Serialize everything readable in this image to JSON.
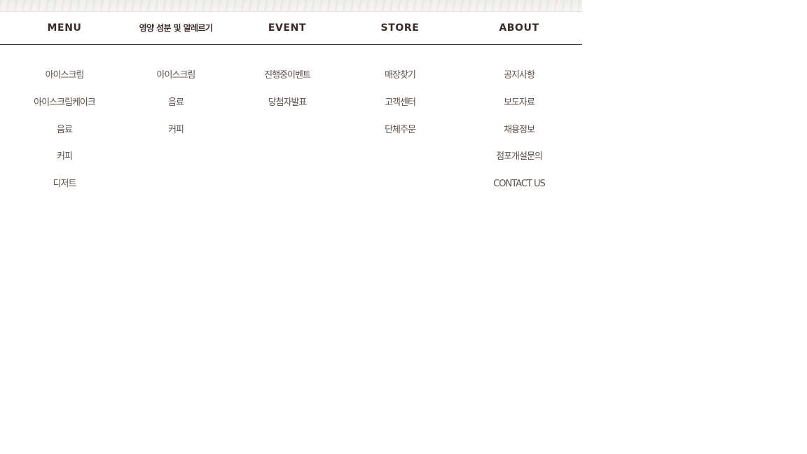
{
  "nav": [
    {
      "label": "MENU"
    },
    {
      "label": "영양 성분 및 알레르기"
    },
    {
      "label": "EVENT"
    },
    {
      "label": "STORE"
    },
    {
      "label": "ABOUT"
    }
  ],
  "submenus": [
    [
      "아이스크림",
      "아이스크림케이크",
      "음료",
      "커피",
      "디저트"
    ],
    [
      "아이스크림",
      "음료",
      "커피"
    ],
    [
      "진행중이벤트",
      "당첨자발표"
    ],
    [
      "매장찾기",
      "고객센터",
      "단체주문"
    ],
    [
      "공지사항",
      "보도자료",
      "채용정보",
      "점포개설문의",
      "CONTACT US"
    ]
  ],
  "colors": {
    "nav_text": "#3c2a28",
    "sub_text": "#5d514c",
    "divider": "#4a3a36"
  }
}
